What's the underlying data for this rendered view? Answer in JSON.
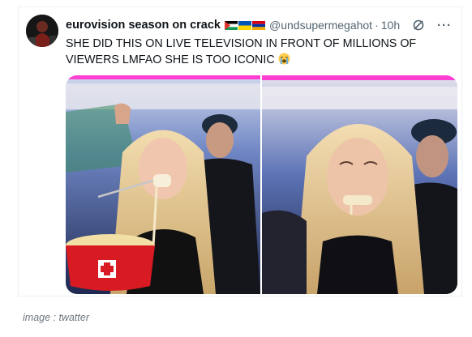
{
  "tweet": {
    "author_name": "eurovision season on crack",
    "handle": "@undsupermegahot",
    "separator": "·",
    "time": "10h",
    "text": "SHE DID THIS ON LIVE TELEVISION IN FRONT OF MILLIONS OF VIEWERS LMFAO SHE IS TOO ICONIC",
    "flags": [
      "palestine-flag",
      "ukraine-flag",
      "armenia-flag"
    ],
    "emoji": "loudly-crying-face",
    "more_label": "···"
  },
  "caption": "image : twatter"
}
